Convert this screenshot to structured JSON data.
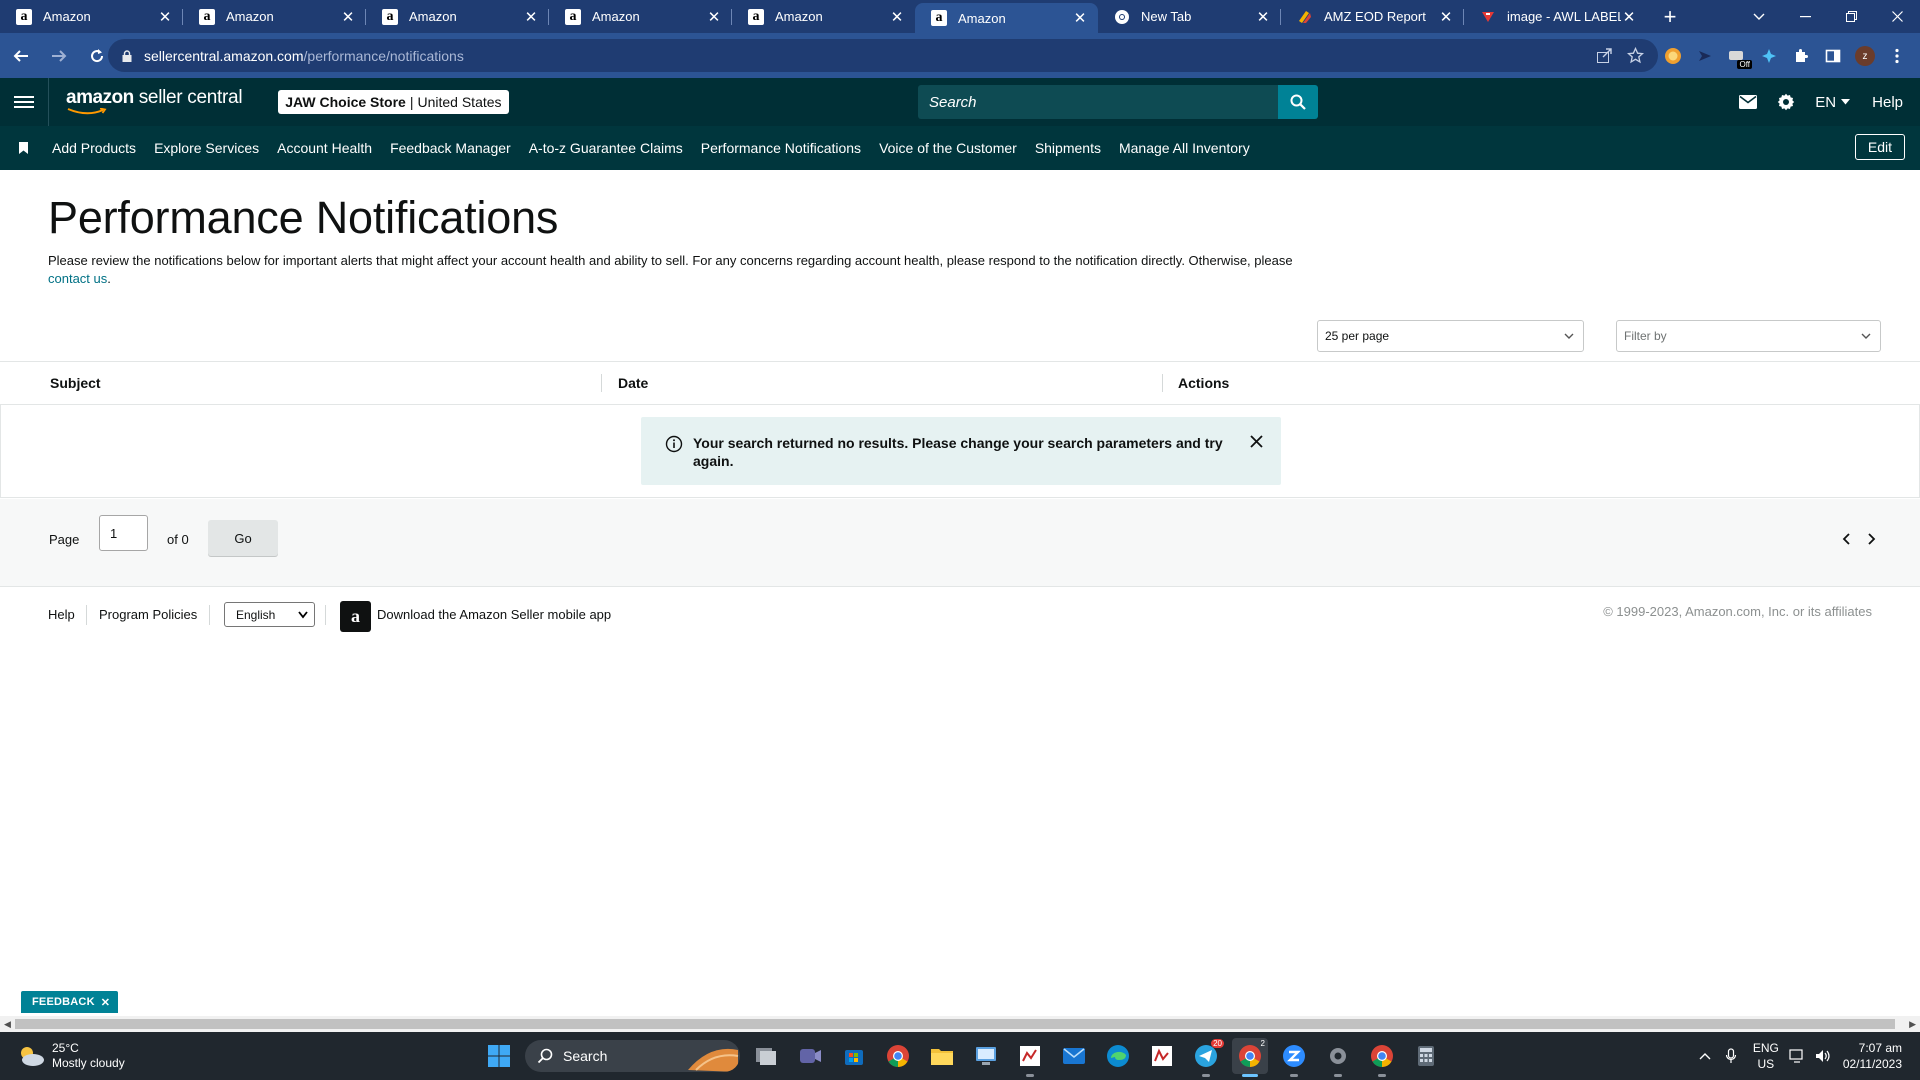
{
  "browser": {
    "tabs": [
      {
        "title": "Amazon",
        "favicon": "amazon-icon",
        "active": false
      },
      {
        "title": "Amazon",
        "favicon": "amazon-icon",
        "active": false
      },
      {
        "title": "Amazon",
        "favicon": "amazon-icon",
        "active": false
      },
      {
        "title": "Amazon",
        "favicon": "amazon-icon",
        "active": false
      },
      {
        "title": "Amazon",
        "favicon": "amazon-icon",
        "active": false
      },
      {
        "title": "Amazon",
        "favicon": "amazon-icon",
        "active": true
      },
      {
        "title": "New Tab",
        "favicon": "chrome-icon",
        "active": false
      },
      {
        "title": "AMZ EOD Report",
        "favicon": "sheets-icon",
        "active": false
      },
      {
        "title": "image - AWL LABEL",
        "favicon": "label-icon",
        "active": false
      }
    ],
    "url_host": "sellercentral.amazon.com",
    "url_path": "/performance/notifications",
    "profile_initial": "z",
    "extension_badge": "Off"
  },
  "header": {
    "logo_bold": "amazon",
    "logo_rest": " seller central",
    "store_name": "JAW Choice Store",
    "marketplace": "United States",
    "store_separator": "|",
    "search_placeholder": "Search",
    "language": "EN",
    "help": "Help"
  },
  "nav": {
    "items": [
      "Add Products",
      "Explore Services",
      "Account Health",
      "Feedback Manager",
      "A-to-z Guarantee Claims",
      "Performance Notifications",
      "Voice of the Customer",
      "Shipments",
      "Manage All Inventory"
    ],
    "edit_label": "Edit"
  },
  "page": {
    "title": "Performance Notifications",
    "description": "Please review the notifications below for important alerts that might affect your account health and ability to sell. For any concerns regarding account health, please respond to the notification directly. Otherwise, please ",
    "contact_link": "contact us",
    "description_end": "."
  },
  "controls": {
    "per_page": "25 per page",
    "filter_placeholder": "Filter by"
  },
  "table": {
    "columns": [
      "Subject",
      "Date",
      "Actions"
    ],
    "rows": [],
    "empty_message": "Your search returned no results. Please change your search parameters and try again."
  },
  "pagination": {
    "page_label": "Page",
    "current_page": "1",
    "of_label": "of 0",
    "go_label": "Go"
  },
  "footer": {
    "help": "Help",
    "program_policies": "Program Policies",
    "language": "English",
    "app_promo": "Download the Amazon Seller mobile app",
    "copyright": "© 1999-2023, Amazon.com, Inc. or its affiliates"
  },
  "feedback": {
    "label": "FEEDBACK"
  },
  "taskbar": {
    "temperature": "25°C",
    "weather": "Mostly cloudy",
    "search_label": "Search",
    "lang_top": "ENG",
    "lang_bottom": "US",
    "time": "7:07 am",
    "date": "02/11/2023",
    "telegram_badge": "20",
    "chrome_badge": "2"
  },
  "colors": {
    "header_bg": "#002f36",
    "nav_bg": "#00363d",
    "accent": "#008296",
    "link": "#007185",
    "browser_frame": "#1f3c72"
  }
}
